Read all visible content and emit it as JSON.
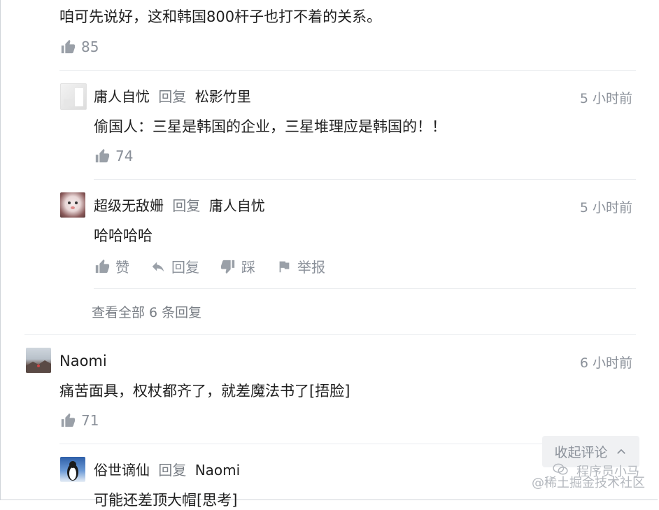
{
  "top_comment": {
    "text": "咱可先说好，这和韩国800杆子也打不着的关系。",
    "likes": "85"
  },
  "replies_top": [
    {
      "author": "庸人自忧",
      "reply_word": "回复",
      "target": "松影竹里",
      "time": "5 小时前",
      "text": "偷国人：三星是韩国的企业，三星堆理应是韩国的！！",
      "likes": "74"
    },
    {
      "author": "超级无敌姗",
      "reply_word": "回复",
      "target": "庸人自忧",
      "time": "5 小时前",
      "text": "哈哈哈哈",
      "actions": {
        "like": "赞",
        "reply": "回复",
        "dislike": "踩",
        "report": "举报"
      }
    }
  ],
  "view_all": "查看全部 6 条回复",
  "comment2": {
    "author": "Naomi",
    "time": "6 小时前",
    "text": "痛苦面具，权杖都齐了，就差魔法书了[捂脸]",
    "likes": "71"
  },
  "reply_bottom": {
    "author": "俗世谪仙",
    "reply_word": "回复",
    "target": "Naomi",
    "text_partial": "可能还差顶大帽[思考]"
  },
  "collapse_button": "收起评论",
  "watermark": {
    "line1": "程序员小马",
    "line2": "@稀土掘金技术社区"
  },
  "colors": {
    "text": "#1f1f1f",
    "meta": "#8a9099",
    "divider": "#ebedf0",
    "button_bg": "#f0f1f3"
  }
}
